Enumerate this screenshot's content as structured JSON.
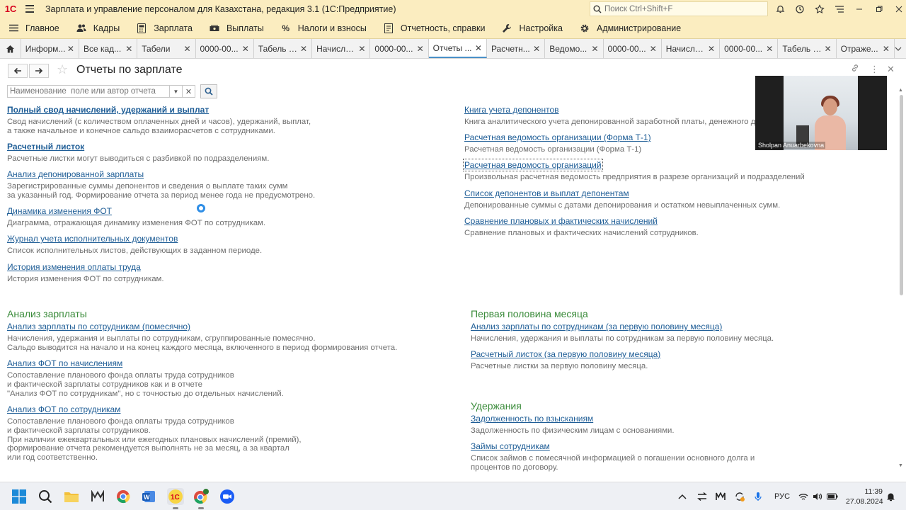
{
  "window": {
    "title": "Зарплата и управление персоналом для Казахстана, редакция 3.1  (1С:Предприятие)",
    "search_placeholder": "Поиск Ctrl+Shift+F"
  },
  "sections": [
    {
      "label": "Главное",
      "icon": "menu-icon"
    },
    {
      "label": "Кадры",
      "icon": "people-icon"
    },
    {
      "label": "Зарплата",
      "icon": "calculator-icon"
    },
    {
      "label": "Выплаты",
      "icon": "cash-icon"
    },
    {
      "label": "Налоги и взносы",
      "icon": "percent-icon"
    },
    {
      "label": "Отчетность, справки",
      "icon": "report-icon"
    },
    {
      "label": "Настройка",
      "icon": "wrench-icon"
    },
    {
      "label": "Администрирование",
      "icon": "gear-icon"
    }
  ],
  "open_tabs": [
    "Информ...",
    "Все кад...",
    "Табели",
    "0000-00...",
    "Табель 0...",
    "Начисле...",
    "0000-00...",
    "Отчеты ...",
    "Расчетн...",
    "Ведомо...",
    "0000-00...",
    "Начисле...",
    "0000-00...",
    "Табель 0...",
    "Отраже..."
  ],
  "active_tab": 7,
  "form": {
    "title": "Отчеты по зарплате",
    "search_placeholder": "Наименование  поле или автор отчета"
  },
  "left_reports": [
    {
      "title": "Полный свод начислений, удержаний и выплат",
      "bold": true,
      "desc": "Свод начислений (с количеством оплаченных дней и часов), удержаний, выплат,\nа также начальное и конечное сальдо взаиморасчетов с сотрудниками."
    },
    {
      "title": "Расчетный листок",
      "bold": true,
      "desc": "Расчетные листки могут выводиться с разбивкой по подразделениям."
    },
    {
      "title": "Анализ депонированной зарплаты",
      "desc": "Зарегистрированные суммы депонентов и сведения о выплате таких сумм\nза указанный год. Формирование отчета за период менее года не предусмотрено."
    },
    {
      "title": "Динамика изменения ФОТ",
      "desc": "Диаграмма, отражающая динамику изменения ФОТ по сотрудникам."
    },
    {
      "title": "Журнал учета исполнительных документов",
      "desc": "Список исполнительных листов, действующих в заданном периоде."
    },
    {
      "title": "История изменения оплаты труда",
      "desc": "История изменения ФОТ по сотрудникам."
    }
  ],
  "right_reports": [
    {
      "title": "Книга учета депонентов",
      "desc": "Книга аналитического учета депонированной заработной платы, денежного дов..."
    },
    {
      "title": "Расчетная ведомость организации (Форма Т-1)",
      "desc": "Расчетная ведомость организации (Форма Т-1)"
    },
    {
      "title": "Расчетная ведомость организаций",
      "focused": true,
      "desc": "Произвольная расчетная ведомость предприятия в разрезе организаций и подразделений"
    },
    {
      "title": "Список депонентов и выплат депонентам",
      "desc": "Депонированные суммы с датами депонирования и остатком невыплаченных сумм."
    },
    {
      "title": "Сравнение плановых и фактических начислений",
      "desc": "Сравнение плановых и фактических начислений сотрудников."
    }
  ],
  "groups": {
    "analysis": {
      "title": "Анализ зарплаты",
      "items": [
        {
          "title": "Анализ зарплаты по сотрудникам (помесячно)",
          "desc": "Начисления, удержания и выплаты по сотрудникам, сгруппированные помесячно.\nСальдо выводится на начало и на конец каждого месяца, включенного в период формирования отчета."
        },
        {
          "title": "Анализ ФОТ по начислениям",
          "desc": "Сопоставление планового фонда оплаты труда сотрудников\nи фактической зарплаты сотрудников как и в отчете\n\"Анализ ФОТ по сотрудникам\", но с точностью до отдельных начислений."
        },
        {
          "title": "Анализ ФОТ по сотрудникам",
          "desc": "Сопоставление планового фонда оплаты труда сотрудников\nи фактической зарплаты сотрудников.\nПри наличии ежеквартальных или ежегодных плановых начислений (премий),\nформирование отчета рекомендуется выполнять не за месяц, а за квартал\nили год соответственно."
        }
      ]
    },
    "first_half": {
      "title": "Первая половина месяца",
      "items": [
        {
          "title": "Анализ зарплаты по сотрудникам (за первую половину месяца)",
          "desc": "Начисления, удержания и выплаты по сотрудникам за первую половину месяца."
        },
        {
          "title": "Расчетный листок (за первую половину месяца)",
          "desc": "Расчетные листки за первую половину месяца."
        }
      ]
    },
    "deductions": {
      "title": "Удержания",
      "items": [
        {
          "title": "Задолженность по взысканиям",
          "desc": "Задолженность по физическим лицам с основаниями."
        },
        {
          "title": "Займы сотрудникам",
          "desc": "Список займов с помесячной информацией о погашении основного долга и\nпроцентов по договору."
        }
      ]
    }
  },
  "video": {
    "participant": "Sholpan Anuarbekovna"
  },
  "taskbar": {
    "language": "РУС",
    "time": "11:39",
    "date": "27.08.2024"
  }
}
